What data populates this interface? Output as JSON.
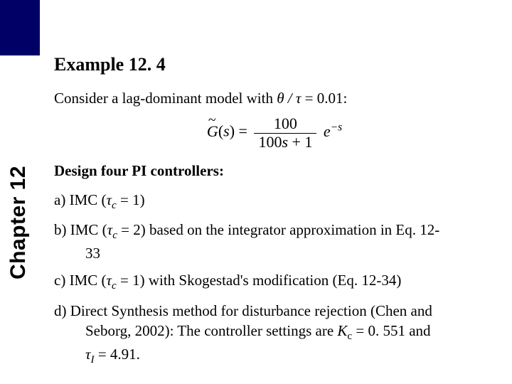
{
  "chapter_label": "Chapter 12",
  "title": "Example 12. 4",
  "intro": {
    "text": "Consider a lag-dominant model with",
    "ratio_lhs": "θ / τ",
    "ratio_eq": "=",
    "ratio_rhs": "0.01:"
  },
  "transfer_function": {
    "lhs_sym": "G",
    "lhs_arg": "s",
    "numerator": "100",
    "denominator_left": "100",
    "denominator_var": "s",
    "denominator_right": " + 1",
    "exp_prefix": "e",
    "exp_power": "−s"
  },
  "design_heading": "Design four PI controllers:",
  "items": {
    "a": {
      "label": "a) IMC",
      "tau_c_sym": "τ",
      "tau_c_sub": "c",
      "tau_c_eq": " = 1"
    },
    "b": {
      "label": "b) IMC",
      "tau_c_sym": "τ",
      "tau_c_sub": "c",
      "tau_c_eq": " = 2",
      "tail": "based on the integrator approximation in Eq. 12-",
      "cont": "33"
    },
    "c": {
      "label": "c) IMC",
      "tau_c_sym": "τ",
      "tau_c_sub": "c",
      "tau_c_eq": " = 1",
      "tail": "with Skogestad's modification (Eq. 12-34)"
    },
    "d": {
      "line1a": "d) Direct Synthesis method for disturbance rejection (Chen and",
      "line2a": "Seborg, 2002): The controller settings are ",
      "kc_sym": "K",
      "kc_sub": "c",
      "kc_val": " = 0. 551 and",
      "tauI_sym": "τ",
      "tauI_sub": "I",
      "tauI_val": " = 4.91."
    }
  }
}
